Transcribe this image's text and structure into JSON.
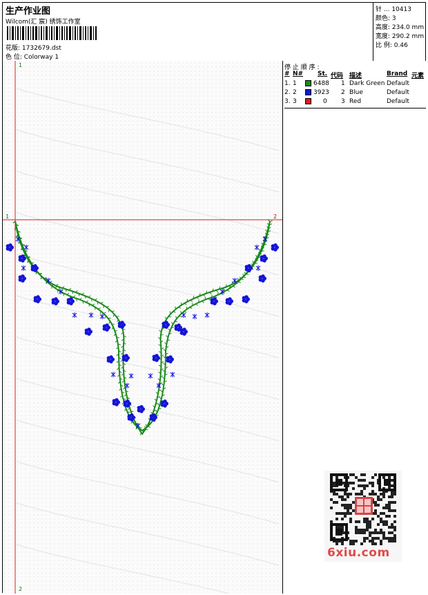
{
  "header": {
    "title": "生产作业图",
    "subtitle": "Wilcom(汇 宸) 绣饰工作室",
    "design_label": "花版:",
    "design_value": "1732679.dst",
    "colorway_label": "色 位:",
    "colorway_value": "Colorway 1"
  },
  "stats": {
    "stitches_label": "针 ...",
    "stitches_value": "10413",
    "colors_label": "颜色:",
    "colors_value": "3",
    "height_label": "高度:",
    "height_value": "234.0 mm",
    "width_label": "宽度:",
    "width_value": "290.2 mm",
    "scale_label": "比 例:",
    "scale_value": "0.46"
  },
  "stop_sequence": {
    "title": "停 止 顺 序 :",
    "headers": [
      "#",
      "N#",
      "St.",
      "代码",
      "描述",
      "Brand",
      "元素"
    ],
    "rows": [
      {
        "num": "1.",
        "n": "1",
        "color": "#1a8a1a",
        "stitches": "6488",
        "code": "1",
        "desc": "Dark Green",
        "brand": "Default"
      },
      {
        "num": "2.",
        "n": "2",
        "color": "#1414d8",
        "stitches": "3923",
        "code": "2",
        "desc": "Blue",
        "brand": "Default"
      },
      {
        "num": "3.",
        "n": "3",
        "color": "#e01a1a",
        "stitches": "0",
        "code": "3",
        "desc": "Red",
        "brand": "Default"
      }
    ]
  },
  "markers": {
    "top_left": "1",
    "left_mid": "1",
    "right_mid": "2",
    "bottom_left": "2"
  },
  "watermark": "6xiu.com",
  "colors": {
    "green": "#1a8a1a",
    "blue": "#1414d8",
    "red_line": "#e01a1a"
  }
}
